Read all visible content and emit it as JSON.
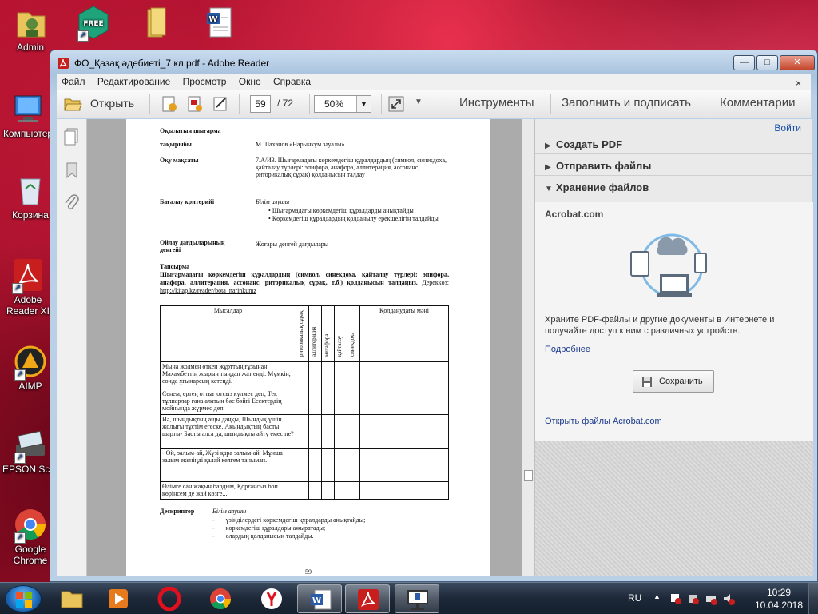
{
  "desktop": {
    "icons": [
      {
        "label": "Admin"
      },
      {
        "label": ""
      },
      {
        "label": ""
      },
      {
        "label": ""
      },
      {
        "label": "Компьютер"
      },
      {
        "label": "Корзина"
      },
      {
        "label": "Adobe Reader XI"
      },
      {
        "label": "AIMP"
      },
      {
        "label": "EPSON Scan"
      },
      {
        "label": "Google Chrome"
      }
    ],
    "free_badge": "FREE"
  },
  "window": {
    "title": "ФО_Қазақ әдебиеті_7 кл.pdf - Adobe Reader",
    "controls": {
      "minimize": "—",
      "maximize": "□",
      "close": "✕"
    }
  },
  "menu": {
    "items": [
      "Файл",
      "Редактирование",
      "Просмотр",
      "Окно",
      "Справка"
    ],
    "close_glyph": "×"
  },
  "toolbar": {
    "open_label": "Открыть",
    "page_current": "59",
    "page_total": "/ 72",
    "zoom": "50%",
    "tabs": [
      "Инструменты",
      "Заполнить и подписать",
      "Комментарии"
    ]
  },
  "right_panel": {
    "login": "Войти",
    "sections": [
      "Создать PDF",
      "Отправить файлы",
      "Хранение файлов"
    ],
    "card_title": "Acrobat.com",
    "card_text": "Храните PDF-файлы и другие документы в Интернете и получайте доступ к ним с различных устройств.",
    "more_link": "Подробнее",
    "save_button": "Сохранить",
    "open_link": "Открыть файлы Acrobat.com"
  },
  "pdf": {
    "heading1": "Оқылатын шығарма",
    "topic_label": "тақырыбы",
    "topic_value": "М.Шаханов «Нарынкұм зауалы»",
    "goal_label": "Оқу мақсаты",
    "goal_value": "7.А/И3. Шығармадағы көркемдегіш құралдардың (символ, синекдоха, қайталау түрлері: эпифора, анафора, аллитерация, ассонанс, риторикалық сұрақ) қолданысын талдау",
    "criteria_label": "Бағалау критерийі",
    "criteria_sub": "Білім алушы",
    "criteria_items": [
      "Шығармадағы көркемдегіш құралдарды анықтайды",
      "Көркемдегіш құралдардың қолданылу ерекшелігін талдайды"
    ],
    "skills_label": "Ойлау дағдыларының деңгейі",
    "skills_value": "Жоғары деңгей дағдылары",
    "task_label": "Тапсырма",
    "task_text": "Шығармадағы көркемдегіш құралдардың (символ, синекдоха, қайталау түрлері: эпифора, анафора, аллитерация, ассонанс, риторикалық сұрақ, т.б.) қолданысын талдаңыз.",
    "source": "Дереккөз:",
    "source_link": "http://kitap.kz/reader/bota_narinkumz",
    "table_headers": [
      "Мысалдар",
      "риторикалық сұрақ",
      "аллитерация",
      "метафора",
      "қайталау",
      "синекдоха",
      "Қолданудағы мәні"
    ],
    "table_rows": [
      "Мына жолмен өткен жұрттың ғұзынан Махамбеттің жырын тыңдап жат енді. Мүмкін, сонда ұғынарсың кетеңді.",
      "Сенем, ертең оттығ отсыз күлмес деп, Тек тұлпарлар ғана алатын бәс бәйгі Есектердің мойнында жүрмес деп.",
      "Иә, шындықтың ащы даңқы, Шындық үшін жолығы тұстім егеске. Ақындықтың басты шарты- Басты алса да, шындықты айту емес пе?",
      "- Ой, залым-ай, Жүзі қара залым-ай, Мұнша залым екеніңді қалай келгем таныман.",
      "Өлімге сан жақын бардым, Қорғансыз боп көрінсем де жай көзге..."
    ],
    "descriptor_label": "Дескриптор",
    "descriptor_sub": "Білім алушы",
    "descriptor_items": [
      "үзінділердегі көркемдегіш құралдарды анықтайды;",
      "көркемдегіш құралдары ажыратады;",
      "олардың қолданысын талдайды."
    ],
    "page_number": "59"
  },
  "taskbar": {
    "lang": "RU",
    "time": "10:29",
    "date": "10.04.2018"
  }
}
